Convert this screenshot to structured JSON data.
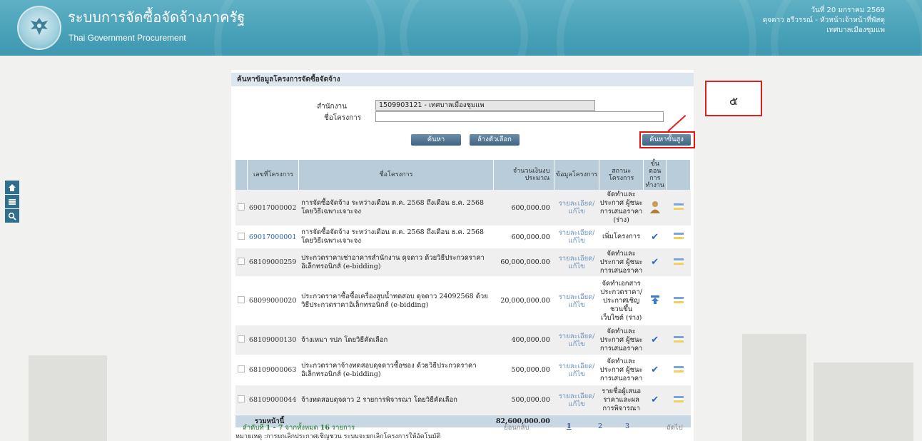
{
  "header": {
    "title_th": "ระบบการจัดซื้อจัดจ้างภาครัฐ",
    "title_en": "Thai Government Procurement",
    "date": "วันที่ 20 มกราคม 2569",
    "user": "ดุจดาว ธรีวรรณ์ - หัวหน้าเจ้าหน้าที่พัสดุ",
    "org": "เทศบาลเมืองชุมแพ"
  },
  "sidebar": {
    "icons": [
      "home-icon",
      "menu-icon",
      "search-icon"
    ]
  },
  "search": {
    "section_title": "ค้นหาข้อมูลโครงการจัดซื้อจัดจ้าง",
    "office_label": "สำนักงาน",
    "office_value": "1509903121 - เทศบาลเมืองชุมแพ",
    "project_label": "ชื่อโครงการ",
    "project_value": "",
    "search_button": "ค้นหา",
    "clear_button": "ล้างตัวเลือก",
    "advanced_button": "ค้นหาขั้นสูง"
  },
  "table": {
    "headers": {
      "project_no": "เลขที่โครงการ",
      "project_name": "ชื่อโครงการ",
      "budget": "จำนวนเงินงบประมาณ",
      "info": "ข้อมูลโครงการ",
      "status": "สถานะโครงการ",
      "step": "ขั้นตอนการทำงาน"
    },
    "rows": [
      {
        "no": "69017000002",
        "name": "การจัดซื้อจัดจ้าง ระหว่างเดือน ต.ค. 2568 ถึงเดือน ธ.ค. 2568 โดยวิธีเฉพาะเจาะจง",
        "amount": "600,000.00",
        "detail": "รายละเอียด/แก้ไข",
        "status": "จัดทำและประกาศ ผู้ชนะการเสนอราคา (ร่าง)"
      },
      {
        "no": "69017000001",
        "name": "การจัดซื้อจัดจ้าง ระหว่างเดือน ต.ค. 2568 ถึงเดือน ธ.ค. 2568 โดยวิธีเฉพาะเจาะจง",
        "amount": "600,000.00",
        "detail": "รายละเอียด/แก้ไข",
        "status": "เพิ่มโครงการ"
      },
      {
        "no": "68109000259",
        "name": "ประกวดราคาเช่าอาคารสำนักงาน ดุจดาว ด้วยวิธีประกวดราคาอิเล็กทรอนิกส์ (e-bidding)",
        "amount": "60,000,000.00",
        "detail": "รายละเอียด/แก้ไข",
        "status": "จัดทำและประกาศ ผู้ชนะการเสนอราคา"
      },
      {
        "no": "68099000020",
        "name": "ประกวดราคาซื้อซื้อเครื่องสูบน้ำทดสอบ ดุจดาว 24092568 ด้วยวิธีประกวดราคาอิเล็กทรอนิกส์ (e-bidding)",
        "amount": "20,000,000.00",
        "detail": "รายละเอียด/แก้ไข",
        "status": "จัดทำเอกสารประกวดราคา/ประกาศเชิญชวนขึ้นเว็บไซต์ (ร่าง)"
      },
      {
        "no": "68109000130",
        "name": "จ้างเหมา รปภ โดยวิธีคัดเลือก",
        "amount": "400,000.00",
        "detail": "รายละเอียด/แก้ไข",
        "status": "จัดทำและประกาศ ผู้ชนะการเสนอราคา"
      },
      {
        "no": "68109000063",
        "name": "ประกวดราคาจ้างทดสอบดุจดาวซื้อซอง ด้วยวิธีประกวดราคาอิเล็กทรอนิกส์ (e-bidding)",
        "amount": "500,000.00",
        "detail": "รายละเอียด/แก้ไข",
        "status": "จัดทำและประกาศ ผู้ชนะการเสนอราคา"
      },
      {
        "no": "68109000044",
        "name": "จ้างทดสอบดุจดาว 2 รายการพิจารณา โดยวิธีคัดเลือก",
        "amount": "500,000.00",
        "detail": "รายละเอียด/แก้ไข",
        "status": "รายชื่อผู้เสนอราคาและผลการพิจารณา"
      }
    ],
    "total_label": "รวมหน้านี้",
    "total_amount": "82,600,000.00"
  },
  "pager": {
    "summary_prefix": "ลำดับที่",
    "range": "1 - 7",
    "of": "จากทั้งหมด",
    "count": "16",
    "unit": "รายการ",
    "prev": "ย้อนกลับ",
    "pages": [
      "1",
      "2",
      "3"
    ],
    "next": "ถัดไป"
  },
  "note": "หมายเหตุ :การยกเลิกประกาศเชิญชวน ระบบจะยกเลิกโครงการให้อัตโนมัติ",
  "callout": {
    "label": "๕"
  }
}
